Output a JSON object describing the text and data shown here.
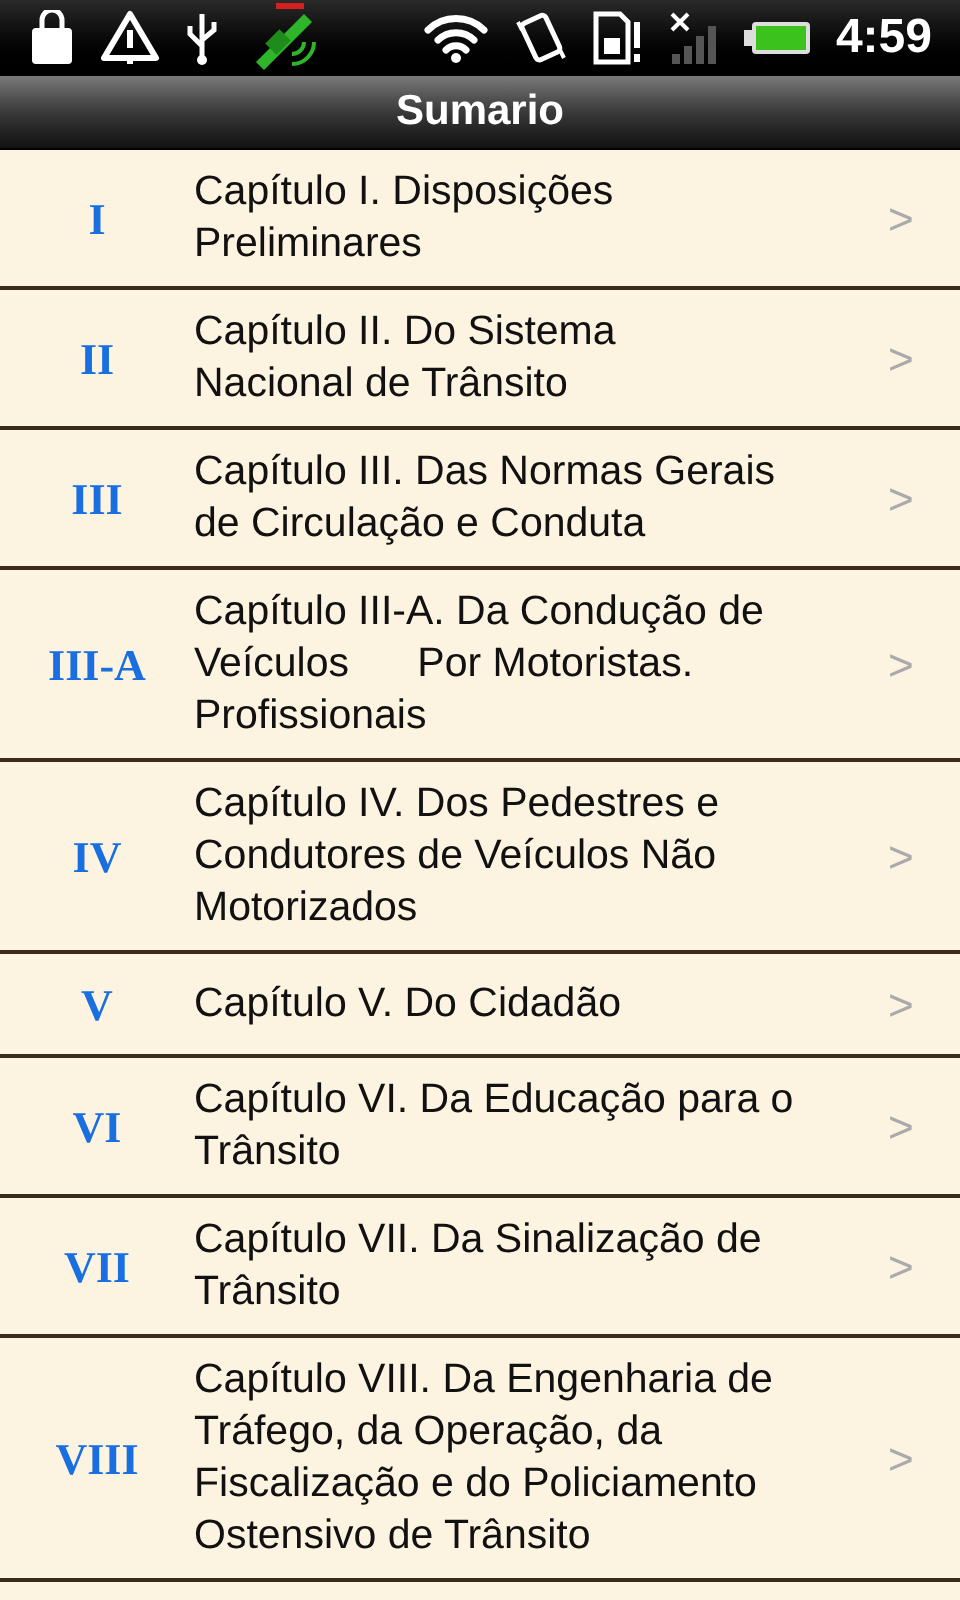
{
  "status_bar": {
    "time": "4:59"
  },
  "title": "Sumario",
  "items": [
    {
      "number": "I",
      "title": "Capítulo I. Disposições\nPreliminares",
      "chevron": ">"
    },
    {
      "number": "II",
      "title": "Capítulo II. Do Sistema\nNacional de Trânsito",
      "chevron": ">"
    },
    {
      "number": "III",
      "title": "Capítulo III. Das Normas Gerais\nde Circulação e Conduta",
      "chevron": ">"
    },
    {
      "number": "III-A",
      "title": "Capítulo III-A. Da Condução de\nVeículos      Por Motoristas.\nProfissionais",
      "chevron": ">"
    },
    {
      "number": "IV",
      "title": "Capítulo IV. Dos Pedestres e\nCondutores de Veículos Não\nMotorizados",
      "chevron": ">"
    },
    {
      "number": "V",
      "title": "Capítulo V. Do Cidadão",
      "chevron": ">"
    },
    {
      "number": "VI",
      "title": "Capítulo VI. Da Educação para o\nTrânsito",
      "chevron": ">"
    },
    {
      "number": "VII",
      "title": "Capítulo VII. Da Sinalização de\nTrânsito",
      "chevron": ">"
    },
    {
      "number": "VIII",
      "title": "Capítulo VIII. Da Engenharia de\nTráfego, da Operação, da\nFiscalização e do Policiamento\nOstensivo de Trânsito",
      "chevron": ">"
    }
  ]
}
